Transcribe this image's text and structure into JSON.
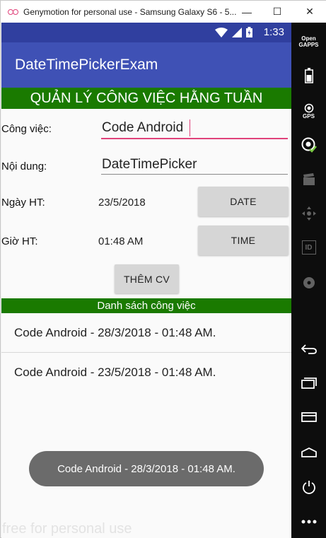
{
  "window": {
    "title": "Genymotion for personal use - Samsung Galaxy S6 - 5...",
    "minimize": "—",
    "maximize": "☐",
    "close": "✕"
  },
  "status_bar": {
    "time": "1:33"
  },
  "app_bar": {
    "title": "DateTimePickerExam"
  },
  "banner": {
    "text": "QUẢN LÝ CÔNG VIỆC HẰNG TUẦN"
  },
  "form": {
    "task_label": "Công việc:",
    "task_value": "Code Android",
    "content_label": "Nội dung:",
    "content_value": "DateTimePicker",
    "date_label": "Ngày HT:",
    "date_value": "23/5/2018",
    "date_button": "DATE",
    "time_label": "Giờ HT:",
    "time_value": "01:48 AM",
    "time_button": "TIME",
    "add_button": "THÊM CV"
  },
  "list": {
    "header": "Danh sách công việc",
    "items": [
      "Code Android - 28/3/2018 - 01:48 AM.",
      "Code Android - 23/5/2018 - 01:48 AM."
    ]
  },
  "toast": {
    "text": "Code Android - 28/3/2018 - 01:48 AM."
  },
  "watermark": {
    "text": "free for personal use"
  },
  "toolbar": {
    "open_gapps_line1": "Open",
    "open_gapps_line2": "GAPPS",
    "gps_label": "GPS",
    "id_label": "ID"
  },
  "colors": {
    "status_bar": "#303f9f",
    "app_bar": "#3f51b5",
    "banner": "#1a7a00",
    "accent_underline": "#e0427a",
    "toast": "#6b6b6b"
  }
}
